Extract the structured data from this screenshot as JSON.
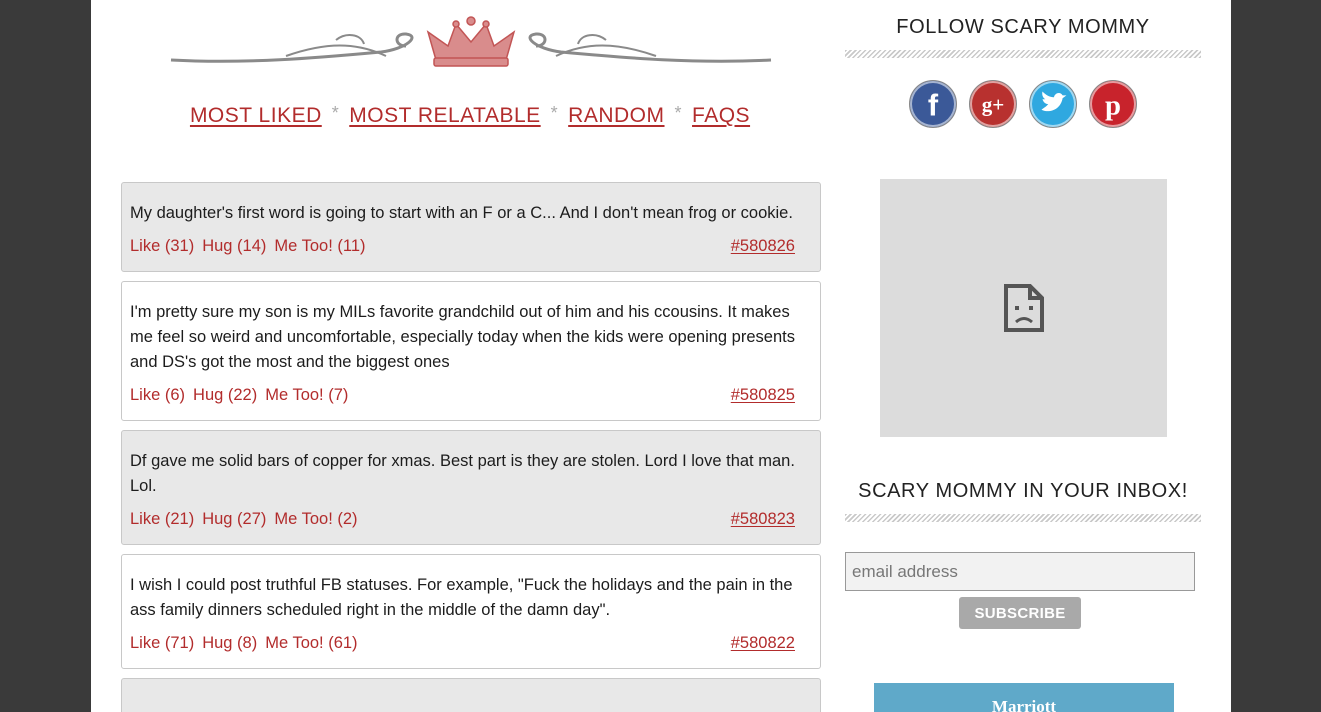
{
  "nav": {
    "items": [
      "MOST LIKED",
      "MOST RELATABLE",
      "RANDOM",
      "FAQS"
    ],
    "separator": "*"
  },
  "posts": [
    {
      "text": "My daughter's first word is going to start with an F or a C... And I don't mean frog or cookie.",
      "like": "Like (31)",
      "hug": "Hug (14)",
      "metoo": "Me Too! (11)",
      "id": "#580826"
    },
    {
      "text": "I'm pretty sure my son is my MILs favorite grandchild out of him and his ccousins. It makes me feel so weird and uncomfortable, especially today when the kids were opening presents and DS's got the most and the biggest ones",
      "like": "Like (6)",
      "hug": "Hug (22)",
      "metoo": "Me Too! (7)",
      "id": "#580825"
    },
    {
      "text": "Df gave me solid bars of copper for xmas. Best part is they are stolen. Lord I love that man. Lol.",
      "like": "Like (21)",
      "hug": "Hug (27)",
      "metoo": "Me Too! (2)",
      "id": "#580823"
    },
    {
      "text": "I wish I could post truthful FB statuses. For example, \"Fuck the holidays and the pain in the ass family dinners scheduled right in the middle of the damn day\".",
      "like": "Like (71)",
      "hug": "Hug (8)",
      "metoo": "Me Too! (61)",
      "id": "#580822"
    }
  ],
  "sidebar": {
    "follow_title": "FOLLOW SCARY MOMMY",
    "social": [
      {
        "icon": "facebook-icon",
        "glyph": "f",
        "color": "#3b5998"
      },
      {
        "icon": "google-plus-icon",
        "glyph": "g+",
        "color": "#b8312f"
      },
      {
        "icon": "twitter-icon",
        "glyph": "t",
        "color": "#2fa8e0"
      },
      {
        "icon": "pinterest-icon",
        "glyph": "p",
        "color": "#c8232c"
      }
    ],
    "newsletter_title": "SCARY MOMMY IN YOUR INBOX!",
    "email_placeholder": "email address",
    "subscribe_label": "SUBSCRIBE",
    "ad_text": "Marriott"
  },
  "colors": {
    "link": "#b22c2c",
    "card_gray": "#e8e8e8",
    "frame": "#3a3a3a"
  }
}
